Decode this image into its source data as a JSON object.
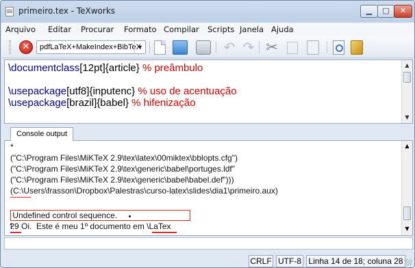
{
  "window": {
    "title": "primeiro.tex - TeXworks",
    "buttons": {
      "minimize": "▁",
      "maximize": "□",
      "close": "✕"
    }
  },
  "menu": [
    "Arquivo",
    "Editar",
    "Procurar",
    "Formato",
    "Compilar",
    "Scripts",
    "Janela",
    "Ajuda"
  ],
  "toolbar": {
    "typeset_engine": "pdfLaTeX+MakeIndex+BibTeX",
    "icons": [
      "stop-icon",
      "new-document-icon",
      "open-folder-icon",
      "save-icon",
      "undo-icon",
      "redo-icon",
      "cut-icon",
      "copy-icon",
      "paste-icon",
      "find-icon",
      "replace-icon"
    ]
  },
  "editor": {
    "lines": [
      {
        "cmd": "\\documentclass",
        "opt": "[12pt]",
        "arg": "{article}",
        "comment": " % preâmbulo"
      },
      {
        "cmd": "",
        "opt": "",
        "arg": "",
        "comment": ""
      },
      {
        "cmd": "\\usepackage",
        "opt": "[utf8]",
        "arg": "{inputenc}",
        "comment": " % uso de acentuação"
      },
      {
        "cmd": "\\usepackage",
        "opt": "[brazil]",
        "arg": "{babel}",
        "comment": " % hifenização"
      }
    ]
  },
  "console": {
    "tab_label": "Console output",
    "lines": [
      "*",
      "(\"C:\\Program Files\\MiKTeX 2.9\\tex\\latex\\00miktex\\bblopts.cfg\")",
      "(\"C:\\Program Files\\MiKTeX 2.9\\tex\\generic\\babel\\portuges.ldf\"",
      "(\"C:\\Program Files\\MiKTeX 2.9\\tex\\generic\\babel\\babel.def\")))",
      "(C:\\Users\\frasson\\Dropbox\\Palestras\\curso-latex\\slides\\dia1\\primeiro.aux)",
      " Undefined control sequence.",
      "l.9 Oi.  Este é meu 1º documento em \\LaTex",
      "",
      "?"
    ]
  },
  "status": {
    "line_ending": "CRLF",
    "encoding": "UTF-8",
    "position": "Linha 14 de 18; coluna 28"
  },
  "colors": {
    "latex_command": "#00008b",
    "comment": "#d80000",
    "error_highlight": "#e0281c"
  }
}
